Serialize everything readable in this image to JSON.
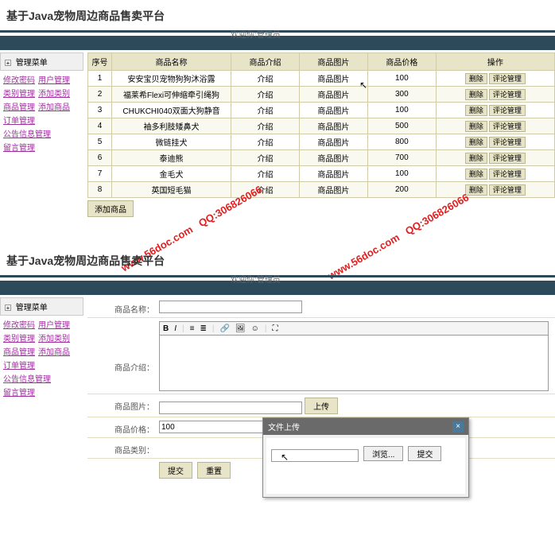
{
  "common": {
    "page_title": "基于Java宠物周边商品售卖平台",
    "welcome": "欢迎你:管理员",
    "sidebar_title": "管理菜单",
    "expand_glyph": "+"
  },
  "sidebar1": {
    "links": [
      {
        "label": "修改密码"
      },
      {
        "label": "用户管理"
      },
      {
        "label": "类别管理"
      },
      {
        "label": "添加类别"
      },
      {
        "label": "商品管理"
      },
      {
        "label": "添加商品"
      },
      {
        "label": "订单管理"
      },
      {
        "label": "公告信息管理"
      },
      {
        "label": "留言管理"
      }
    ]
  },
  "sidebar2": {
    "links": [
      {
        "label": "修改密码"
      },
      {
        "label": "用户管理"
      },
      {
        "label": "类别管理"
      },
      {
        "label": "添加类别"
      },
      {
        "label": "商品管理"
      },
      {
        "label": "添加商品"
      },
      {
        "label": "订单管理"
      },
      {
        "label": "公告信息管理"
      },
      {
        "label": "留言管理"
      }
    ]
  },
  "table": {
    "cols": [
      "序号",
      "商品名称",
      "商品介绍",
      "商品图片",
      "商品价格",
      "操作"
    ],
    "rows": [
      {
        "no": "1",
        "name": "安安宝贝宠物狗狗沐浴露",
        "intro": "介绍",
        "img": "商品图片",
        "price": "100"
      },
      {
        "no": "2",
        "name": "福莱希Flexi可伸缩牵引绳狗",
        "intro": "介绍",
        "img": "商品图片",
        "price": "300"
      },
      {
        "no": "3",
        "name": "CHUKCHI040双面大狗静音",
        "intro": "介绍",
        "img": "商品图片",
        "price": "100"
      },
      {
        "no": "4",
        "name": "袖多利肢矮鼻犬",
        "intro": "介绍",
        "img": "商品图片",
        "price": "500"
      },
      {
        "no": "5",
        "name": "微链挂犬",
        "intro": "介绍",
        "img": "商品图片",
        "price": "800"
      },
      {
        "no": "6",
        "name": "泰迪熊",
        "intro": "介绍",
        "img": "商品图片",
        "price": "700"
      },
      {
        "no": "7",
        "name": "金毛犬",
        "intro": "介绍",
        "img": "商品图片",
        "price": "100"
      },
      {
        "no": "8",
        "name": "英国短毛猫",
        "intro": "介绍",
        "img": "商品图片",
        "price": "200"
      }
    ],
    "row_delete": "删除",
    "row_comment": "评论管理",
    "add_link": "添加商品"
  },
  "form": {
    "name_label": "商品名称：",
    "intro_label": "商品介绍：",
    "pic_label": "商品图片：",
    "price_label": "商品价格：",
    "price_value": "100",
    "cat_label": "商品类别：",
    "upload_btn": "上传",
    "submit_btn": "提交",
    "reset_btn": "重置"
  },
  "modal": {
    "title": "文件上传",
    "browse": "浏览...",
    "submit": "提交",
    "close_glyph": "×"
  },
  "watermark": {
    "url": "www.56doc.com",
    "qq": "QQ:306826066"
  }
}
